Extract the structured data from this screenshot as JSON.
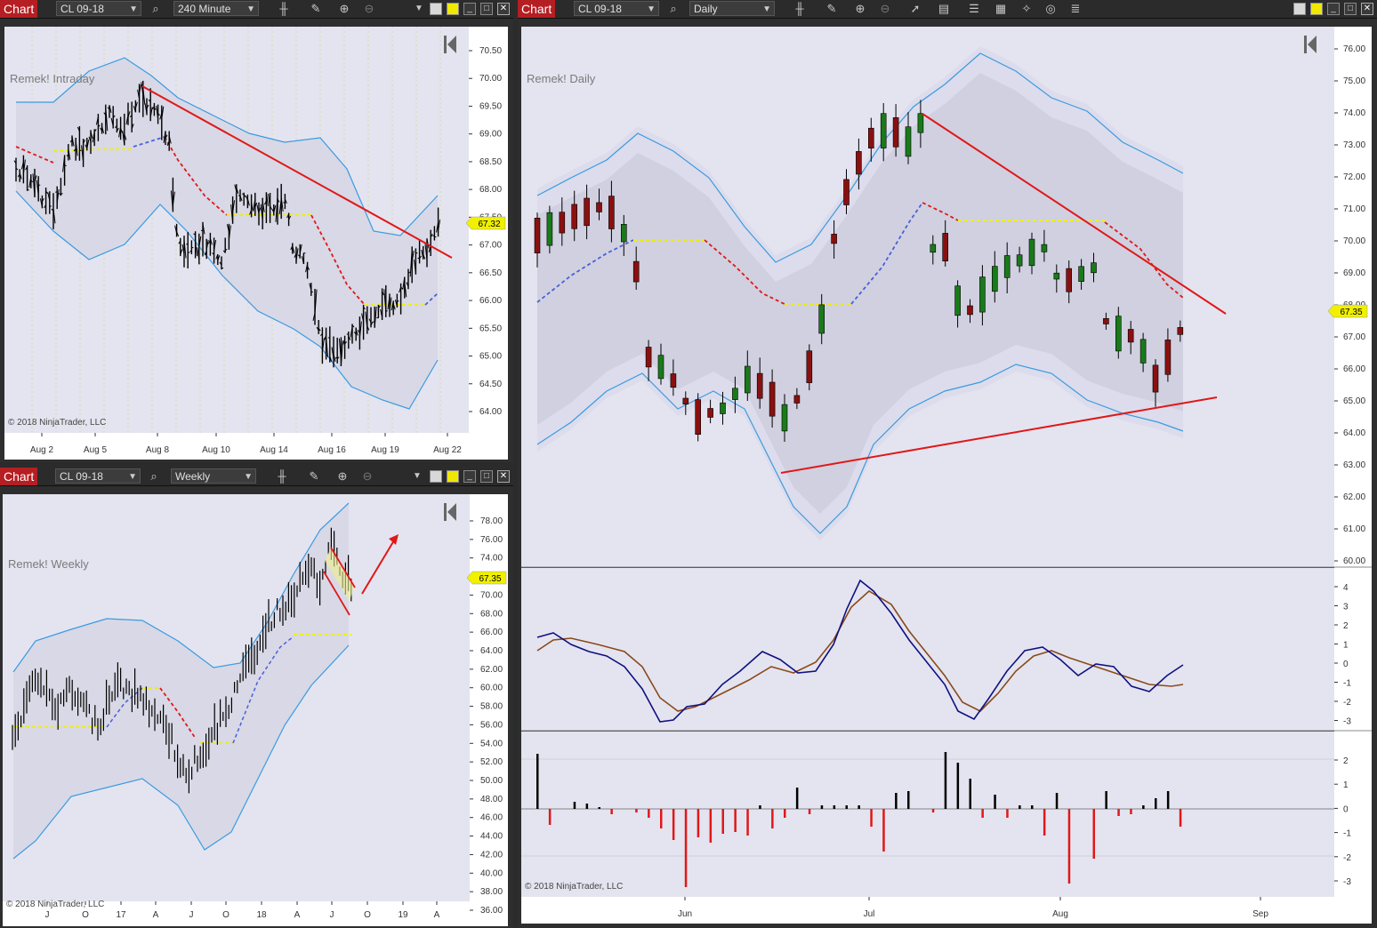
{
  "windows": [
    {
      "id": "intraday",
      "label": "Chart",
      "instrument": "CL 09-18",
      "interval": "240 Minute",
      "title": "Remek! Intraday",
      "copyright": "© 2018 NinjaTrader, LLC",
      "price_marker": "67.32",
      "y_ticks": [
        "70.50",
        "70.00",
        "69.50",
        "69.00",
        "68.50",
        "68.00",
        "67.50",
        "67.00",
        "66.50",
        "66.00",
        "65.50",
        "65.00",
        "64.50",
        "64.00"
      ],
      "x_ticks": [
        "Aug 2",
        "Aug 5",
        "Aug 8",
        "Aug 10",
        "Aug 14",
        "Aug 16",
        "Aug 19",
        "Aug 22"
      ]
    },
    {
      "id": "weekly",
      "label": "Chart",
      "instrument": "CL 09-18",
      "interval": "Weekly",
      "title": "Remek! Weekly",
      "copyright": "© 2018 NinjaTrader, LLC",
      "price_marker": "67.35",
      "y_ticks": [
        "78.00",
        "76.00",
        "74.00",
        "72.00",
        "70.00",
        "68.00",
        "66.00",
        "64.00",
        "62.00",
        "60.00",
        "58.00",
        "56.00",
        "54.00",
        "52.00",
        "50.00",
        "48.00",
        "46.00",
        "44.00",
        "42.00",
        "40.00",
        "38.00",
        "36.00"
      ],
      "x_ticks": [
        "J",
        "O",
        "17",
        "A",
        "J",
        "O",
        "18",
        "A",
        "J",
        "O",
        "19",
        "A"
      ]
    },
    {
      "id": "daily",
      "label": "Chart",
      "instrument": "CL 09-18",
      "interval": "Daily",
      "title": "Remek! Daily",
      "copyright": "© 2018 NinjaTrader, LLC",
      "price_marker": "67.35",
      "y_ticks": [
        "76.00",
        "75.00",
        "74.00",
        "73.00",
        "72.00",
        "71.00",
        "70.00",
        "69.00",
        "68.00",
        "67.00",
        "66.00",
        "65.00",
        "64.00",
        "63.00",
        "62.00",
        "61.00",
        "60.00"
      ],
      "osc_ticks": [
        "4",
        "3",
        "2",
        "1",
        "0",
        "-1",
        "-2",
        "-3"
      ],
      "hist_ticks": [
        "2",
        "1",
        "0",
        "-1",
        "-2",
        "-3"
      ],
      "x_ticks": [
        "Jun",
        "Jul",
        "Aug",
        "Sep"
      ]
    }
  ],
  "colors": {
    "chart_bg": "#e4e4f0",
    "band_fill": "#d6d6e4",
    "band_line": "#3a9be0",
    "trend_line": "#e01818",
    "mid_red": "#e01818",
    "mid_blue": "#4a60d8",
    "mid_yellow": "#f0f000",
    "bull": "#1a7a1a",
    "bear": "#8a1010",
    "osc_fast": "#101080",
    "osc_slow": "#8a4a1a",
    "hist_pos": "#000000",
    "hist_neg": "#e01818",
    "marker": "#f0f000"
  }
}
